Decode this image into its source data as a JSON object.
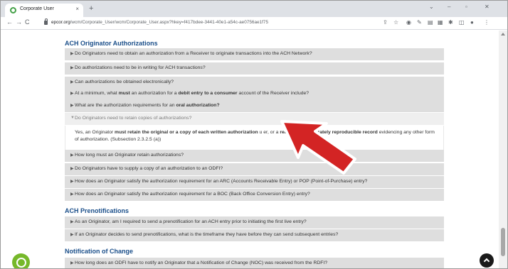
{
  "browser": {
    "tab_title": "Corporate User",
    "tab_close": "×",
    "new_tab": "+",
    "window_controls": [
      "⌄",
      "–",
      "▫",
      "✕"
    ],
    "nav": [
      "←",
      "→",
      "C"
    ],
    "url_host": "epcor.org",
    "url_path": "/wcm/Corporate_User/wcm/Corporate_User.aspx?hkey=f417bdee-3441-40e1-a54c-ae0756ae1f75",
    "toolbar_icons": [
      "share-icon",
      "star-icon",
      "shield-icon",
      "pen-icon",
      "extension-icon",
      "grid-icon",
      "puzzle-icon",
      "sidebar-icon",
      "profile-icon",
      "menu-icon"
    ],
    "toolbar_glyphs": [
      "⇪",
      "☆",
      "◉",
      "✎",
      "▤",
      "▦",
      "✱",
      "◫",
      "●",
      "⋮"
    ]
  },
  "sections": [
    {
      "title": "ACH Originator Authorizations",
      "items": [
        {
          "q": "Do Originators need to obtain an authorization from a Receiver to originate transactions into the ACH Network?"
        },
        {
          "q": "Do authorizations need to be in writing for ACH transactions?"
        },
        {
          "q": "Can authorizations be obtained electronically?"
        },
        {
          "q_parts": [
            "At a minimum, what ",
            "must",
            " an authorization for a ",
            "debit entry to a consumer",
            " account of the Receiver include?"
          ]
        },
        {
          "q_parts": [
            "What are the authorization requirements for an ",
            "oral authorization?"
          ]
        },
        {
          "q": "Do Originators need to retain copies of authorizations?",
          "open": true,
          "answer_parts": [
            "Yes, an Originator ",
            "must retain the original or a copy of each written authorization",
            " u                   er, or a ",
            "readily and accurately reproducible record",
            " evidencing any other form of authorization. (Subsection 2.3.2.5 (a))"
          ]
        },
        {
          "q": "How long must an Originator retain authorizations?"
        },
        {
          "q": "Do Originators have to supply a copy of an authorization to an ODFI?"
        },
        {
          "q": "How does an Originator satisfy the authorization requirement for an ARC (Accounts Receivable Entry) or POP (Point-of-Purchase) entry?"
        },
        {
          "q": "How does an Originator satisfy the authorization requirement for a BOC (Back Office Conversion Entry) entry?"
        }
      ]
    },
    {
      "title": "ACH Prenotifications",
      "items": [
        {
          "q": "As an Originator, am I required to send a prenotification for an ACH entry prior to initiating the first live entry?"
        },
        {
          "q": "If an Originator decides to send prenotifications, what is the timeframe they have before they can send subsequent entries?"
        }
      ]
    },
    {
      "title": "Notification of Change",
      "items": [
        {
          "q": "How long does an ODFI have to notify an Originator that a Notification of Change (NOC) was received from the RDFI?"
        }
      ]
    }
  ],
  "overlay": {
    "arrow_color": "#d32424",
    "arrow_outline": "#ffffff"
  },
  "colors": {
    "section_title": "#1b4f8a",
    "row_bg": "#dedede",
    "chat_green": "#76b82a"
  }
}
